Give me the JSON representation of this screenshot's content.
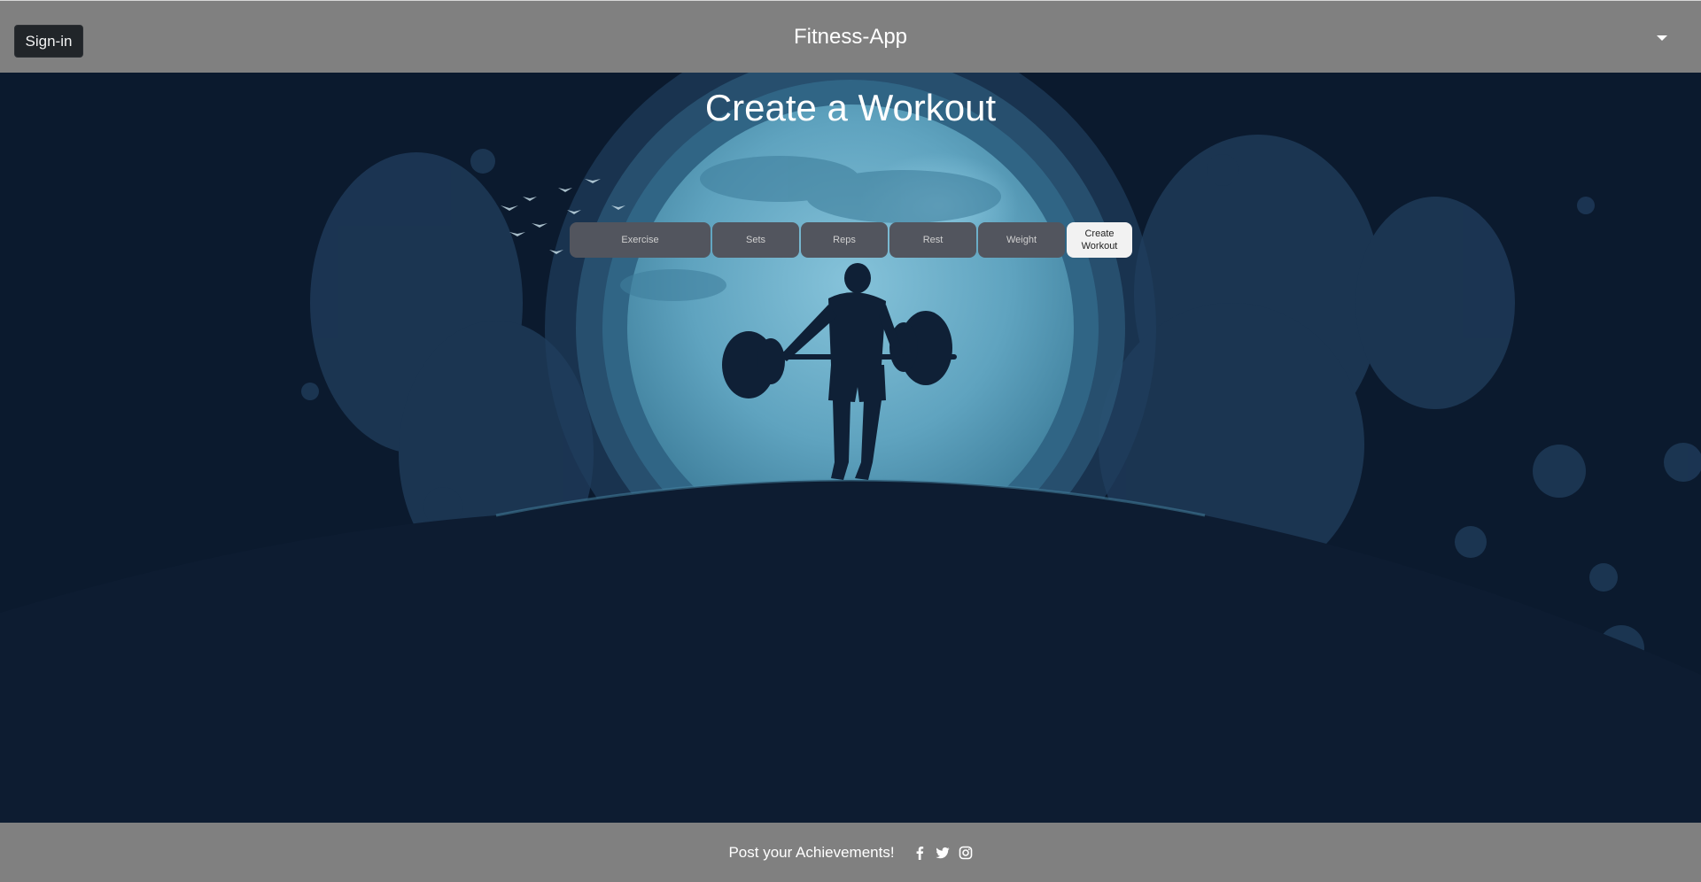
{
  "navbar": {
    "signin_label": "Sign-in",
    "brand": "Fitness-App",
    "dropdown_icon": "caret-down-icon"
  },
  "hero": {
    "title": "Create a Workout",
    "background": "weightlifter-moon-illustration"
  },
  "form": {
    "exercise_placeholder": "Exercise",
    "sets_placeholder": "Sets",
    "reps_placeholder": "Reps",
    "rest_placeholder": "Rest",
    "weight_placeholder": "Weight",
    "submit_label": "Create Workout"
  },
  "footer": {
    "text": "Post your Achievements!",
    "social_icons": [
      "facebook-icon",
      "twitter-icon",
      "instagram-icon"
    ]
  },
  "colors": {
    "navbar_bg": "#808080",
    "hero_dark": "#0b1a2e",
    "moon": "#5fa3bf",
    "button_dark": "#212529",
    "field_bg": "#52555e"
  }
}
